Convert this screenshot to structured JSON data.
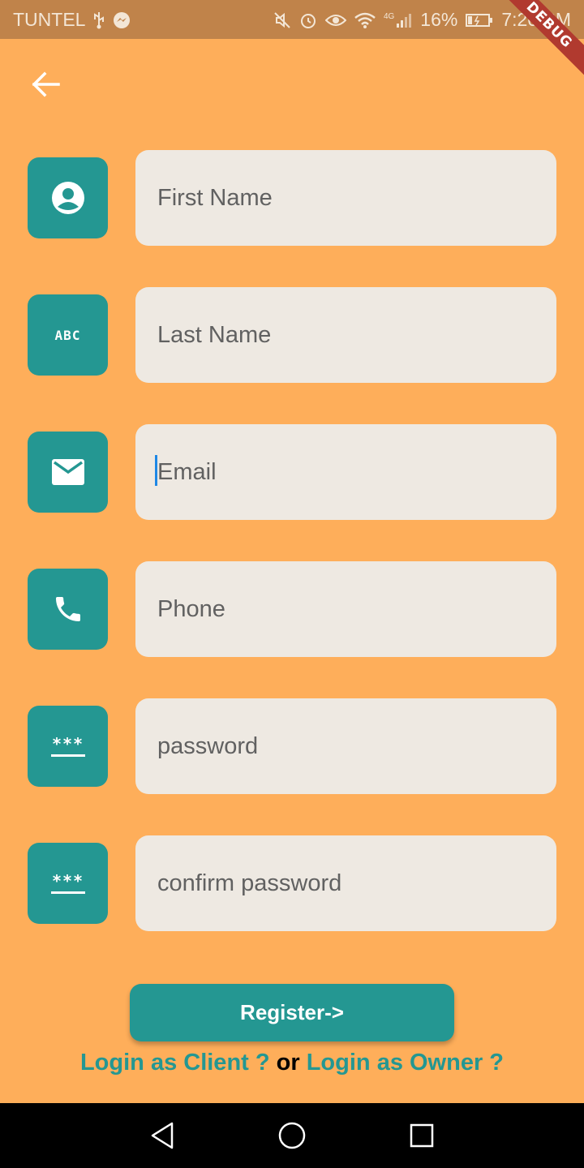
{
  "status_bar": {
    "carrier": "TUNTEL",
    "network": "4G",
    "battery": "16%",
    "time": "7:20 PM",
    "icons_left": [
      "usb-icon",
      "messenger-icon"
    ],
    "icons_right": [
      "mute-icon",
      "alarm-icon",
      "eye-icon",
      "wifi-icon",
      "signal-icon",
      "battery-icon"
    ]
  },
  "debug_banner": "DEBUG",
  "form": {
    "fields": [
      {
        "icon": "account-circle-icon",
        "placeholder": "First Name",
        "value": ""
      },
      {
        "icon": "abc-icon",
        "icon_text": "ABC",
        "placeholder": "Last Name",
        "value": ""
      },
      {
        "icon": "mail-icon",
        "placeholder": "Email",
        "value": "",
        "focused": true
      },
      {
        "icon": "phone-icon",
        "placeholder": "Phone",
        "value": ""
      },
      {
        "icon": "password-icon",
        "icon_text": "***",
        "placeholder": "password",
        "value": ""
      },
      {
        "icon": "password-icon",
        "icon_text": "***",
        "placeholder": "confirm password",
        "value": ""
      }
    ],
    "register_label": "Register->",
    "login_client": "Login as Client ?",
    "or_text": " or ",
    "login_owner": "Login as Owner ?"
  },
  "colors": {
    "background": "#feae5a",
    "accent": "#249792",
    "field_bg": "#eee9e2",
    "status_bar": "#c0834a",
    "debug_ribbon": "#b13a2f"
  }
}
